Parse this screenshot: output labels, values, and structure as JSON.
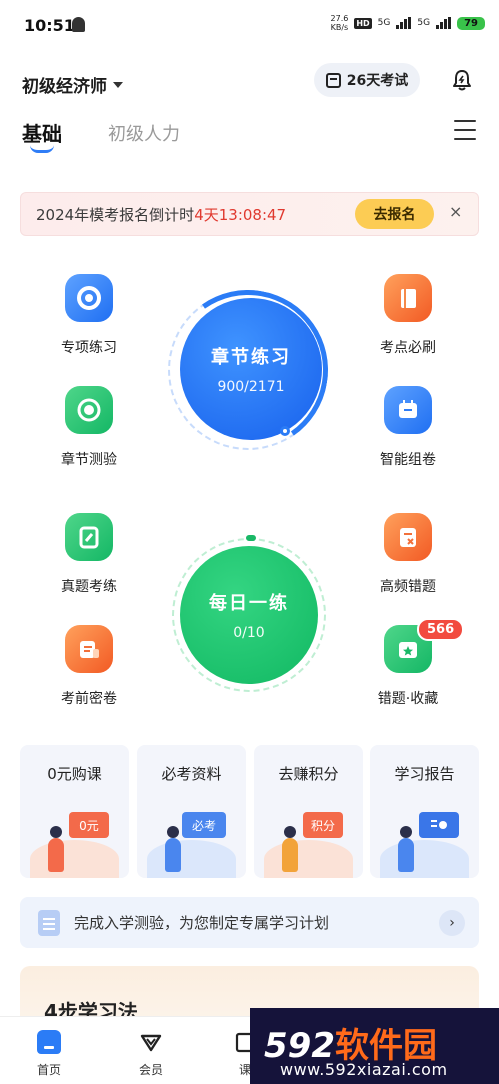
{
  "status_bar": {
    "time": "10:51",
    "net_speed_value": "27.6",
    "net_speed_unit": "KB/s",
    "hd_label": "HD",
    "signal1_label": "5G",
    "signal2_label": "5G",
    "battery": "79"
  },
  "header": {
    "exam_selector": "初级经济师",
    "countdown_pill": "26天考试"
  },
  "tabs": {
    "active": "基础",
    "inactive": "初级人力"
  },
  "banner": {
    "text": "2024年模考报名倒计时",
    "time": "4天13:08:47",
    "button": "去报名",
    "close": "×"
  },
  "features": {
    "left": [
      "专项练习",
      "章节测验",
      "真题考练",
      "考前密卷"
    ],
    "right": [
      "考点必刷",
      "智能组卷",
      "高频错题",
      "错题·收藏"
    ],
    "badge": "566"
  },
  "chapter_practice": {
    "title": "章节练习",
    "progress_text": "900/2171",
    "done": 900,
    "total": 2171
  },
  "daily_practice": {
    "title": "每日一练",
    "progress_text": "0/10",
    "done": 0,
    "total": 10
  },
  "promo_cards": [
    {
      "title": "0元购课",
      "art_text": "0元"
    },
    {
      "title": "必考资料",
      "art_text": "必考"
    },
    {
      "title": "去赚积分",
      "art_text": "积分"
    },
    {
      "title": "学习报告",
      "art_text": ""
    }
  ],
  "plan_bar": {
    "text": "完成入学测验，为您制定专属学习计划",
    "arrow": "›"
  },
  "study_method": {
    "title": "4步学习法"
  },
  "tabbar": {
    "home": "首页",
    "member": "会员",
    "course_partial": "课"
  },
  "watermark": {
    "brand_num": "592",
    "brand_text": "软件园",
    "url": "www.592xiazai.com"
  },
  "colors": {
    "accent_blue": "#2b7cf6",
    "accent_green": "#19b866",
    "banner_time_red": "#e0392f",
    "banner_button": "#fccc54",
    "badge_red": "#f24b3f"
  }
}
